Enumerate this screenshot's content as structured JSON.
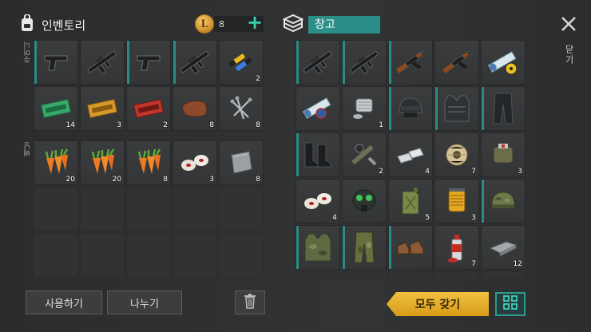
{
  "inventory": {
    "title": "인벤토리",
    "coins": "8",
    "side_label_top": "주머니",
    "side_label_bottom": "배낭",
    "top_slots": [
      {
        "icon": "pistol-icon",
        "qty": "",
        "mark": true
      },
      {
        "icon": "rifle-icon",
        "qty": "",
        "mark": false
      },
      {
        "icon": "pistol-icon",
        "qty": "",
        "mark": true
      },
      {
        "icon": "rifle-icon",
        "qty": "",
        "mark": true
      },
      {
        "icon": "batteries-icon",
        "qty": "2",
        "mark": false
      },
      {
        "icon": "green-coupon-icon",
        "qty": "14",
        "mark": false
      },
      {
        "icon": "gold-coupon-icon",
        "qty": "3",
        "mark": false
      },
      {
        "icon": "red-coupon-icon",
        "qty": "2",
        "mark": false
      },
      {
        "icon": "leather-icon",
        "qty": "8",
        "mark": false
      },
      {
        "icon": "nails-icon",
        "qty": "8",
        "mark": false
      }
    ],
    "bag_slots": [
      {
        "icon": "carrot-icon",
        "qty": "20"
      },
      {
        "icon": "carrot-icon",
        "qty": "20"
      },
      {
        "icon": "carrot-icon",
        "qty": "8"
      },
      {
        "icon": "cloth-icon",
        "qty": "3"
      },
      {
        "icon": "iron-plate-icon",
        "qty": "8"
      },
      {
        "icon": "",
        "qty": ""
      },
      {
        "icon": "",
        "qty": ""
      },
      {
        "icon": "",
        "qty": ""
      },
      {
        "icon": "",
        "qty": ""
      },
      {
        "icon": "",
        "qty": ""
      },
      {
        "icon": "",
        "qty": ""
      },
      {
        "icon": "",
        "qty": ""
      },
      {
        "icon": "",
        "qty": ""
      },
      {
        "icon": "",
        "qty": ""
      },
      {
        "icon": "",
        "qty": ""
      }
    ],
    "use_label": "사용하기",
    "split_label": "나누기"
  },
  "storage": {
    "title": "창고",
    "slots": [
      {
        "icon": "rifle-icon",
        "qty": "",
        "mark": true
      },
      {
        "icon": "rifle-icon",
        "qty": "",
        "mark": true
      },
      {
        "icon": "ak-rifle-icon",
        "qty": "",
        "mark": true
      },
      {
        "icon": "ak-rifle-icon",
        "qty": "",
        "mark": false
      },
      {
        "icon": "blueprint-radiation-icon",
        "qty": "",
        "mark": false
      },
      {
        "icon": "blueprint-icon",
        "qty": "",
        "mark": false
      },
      {
        "icon": "engine-part-icon",
        "qty": "1",
        "mark": false
      },
      {
        "icon": "helmet-icon",
        "qty": "",
        "mark": true
      },
      {
        "icon": "vest-icon",
        "qty": "",
        "mark": true
      },
      {
        "icon": "pants-icon",
        "qty": "",
        "mark": true
      },
      {
        "icon": "boots-icon",
        "qty": "",
        "mark": true
      },
      {
        "icon": "parts-icon",
        "qty": "2",
        "mark": false
      },
      {
        "icon": "silver-bars-icon",
        "qty": "4",
        "mark": false
      },
      {
        "icon": "wire-spool-icon",
        "qty": "7",
        "mark": false
      },
      {
        "icon": "medkit-bag-icon",
        "qty": "3",
        "mark": false
      },
      {
        "icon": "cloth-icon",
        "qty": "4",
        "mark": false
      },
      {
        "icon": "gas-mask-icon",
        "qty": "",
        "mark": false
      },
      {
        "icon": "jerrycan-icon",
        "qty": "5",
        "mark": false
      },
      {
        "icon": "filter-icon",
        "qty": "3",
        "mark": false
      },
      {
        "icon": "camo-cap-icon",
        "qty": "",
        "mark": true
      },
      {
        "icon": "camo-vest-icon",
        "qty": "",
        "mark": true
      },
      {
        "icon": "camo-pants-icon",
        "qty": "",
        "mark": true
      },
      {
        "icon": "shoes-icon",
        "qty": "",
        "mark": true
      },
      {
        "icon": "spray-can-icon",
        "qty": "7",
        "mark": false
      },
      {
        "icon": "iron-bar-icon",
        "qty": "12",
        "mark": false
      },
      {
        "icon": "",
        "qty": "",
        "mark": false
      },
      {
        "icon": "",
        "qty": "",
        "mark": false
      },
      {
        "icon": "",
        "qty": "",
        "mark": false
      },
      {
        "icon": "",
        "qty": "",
        "mark": false
      },
      {
        "icon": "",
        "qty": "",
        "mark": false
      }
    ],
    "take_all_label": "모두 갖기"
  },
  "close_label": "닫기",
  "colors": {
    "accent": "#2b8e89",
    "gold": "#f1c13f",
    "background": "#2d2f30"
  }
}
